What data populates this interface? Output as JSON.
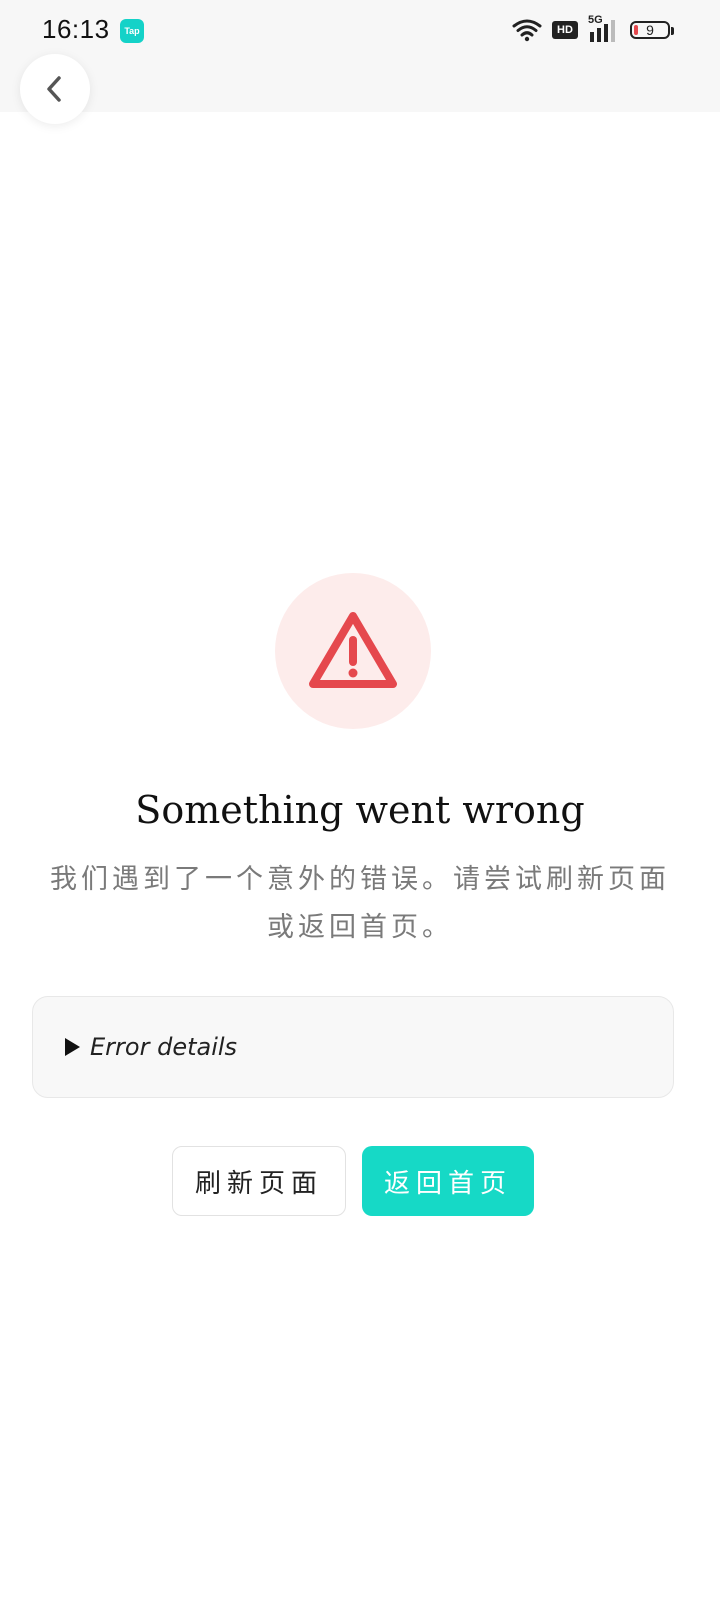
{
  "status_bar": {
    "time": "16:13",
    "app_badge": "Tap",
    "network_hd": "HD",
    "network_5g": "5G",
    "battery_level": "9"
  },
  "error": {
    "title": "Something went wrong",
    "message": "我们遇到了一个意外的错误。请尝试刷新页面或返回首页。",
    "details_label": "Error details"
  },
  "actions": {
    "refresh_label": "刷新页面",
    "home_label": "返回首页"
  },
  "colors": {
    "accent": "#16d9c6",
    "error_red": "#e5484d",
    "error_bg": "#fdeceb"
  },
  "icons": {
    "back": "chevron-left-icon",
    "error": "warning-triangle-icon"
  }
}
